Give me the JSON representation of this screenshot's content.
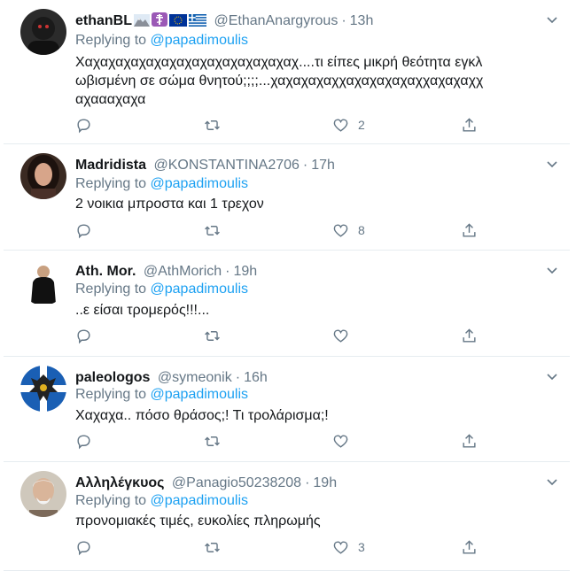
{
  "tweets": [
    {
      "name": "ethanBL",
      "handle": "@EthanAnargyrous",
      "time": "13h",
      "replying_label": "Replying to",
      "replying_to": "@papadimoulis",
      "text": "Χαχαχαχαχαχαχαχαχαχαχαχαχαχαχ....τι είπες μικρή θεότητα εγκλωβισμένη σε σώμα θνητού;;;;...χαχαχαχαχχαχαχαχαχαχχαχαχαχχαχαααχαχα",
      "likes": "2",
      "emoji": [
        "mountain-emoji",
        "orthodox-cross-emoji",
        "eu-flag-emoji",
        "greek-flag-emoji"
      ]
    },
    {
      "name": "Madridista",
      "handle": "@KONSTANTINA2706",
      "time": "17h",
      "replying_label": "Replying to",
      "replying_to": "@papadimoulis",
      "text": "2 νοικια μπροστα και 1 τρεχον",
      "likes": "8"
    },
    {
      "name": "Ath. Mor.",
      "handle": "@AthMorich",
      "time": "19h",
      "replying_label": "Replying to",
      "replying_to": "@papadimoulis",
      "text": "..ε είσαι τρομερός!!!...",
      "likes": ""
    },
    {
      "name": "paleologos",
      "handle": "@symeonik",
      "time": "16h",
      "replying_label": "Replying to",
      "replying_to": "@papadimoulis",
      "text": "Χαχαχα.. πόσο θράσος;! Τι τρολάρισμα;!",
      "likes": ""
    },
    {
      "name": "Αλληλέγκυος",
      "handle": "@Panagio50238208",
      "time": "19h",
      "replying_label": "Replying to",
      "replying_to": "@papadimoulis",
      "text": "προνομιακές τιμές, ευκολίες πληρωμής",
      "likes": "3"
    }
  ],
  "separator": "·",
  "colors": {
    "link": "#1da1f2",
    "muted": "#657786",
    "text": "#14171a",
    "border": "#e6ecf0"
  },
  "icons": [
    "reply-icon",
    "retweet-icon",
    "like-icon",
    "share-icon",
    "chevron-down-icon"
  ]
}
